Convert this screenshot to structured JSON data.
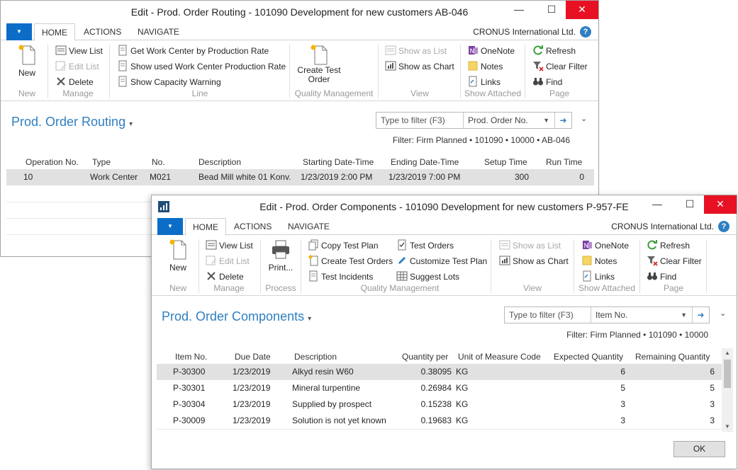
{
  "win1": {
    "title": "Edit - Prod. Order Routing - 101090 Development for new customers AB-046",
    "tabs": [
      "HOME",
      "ACTIONS",
      "NAVIGATE"
    ],
    "company": "CRONUS International Ltd.",
    "help": "?",
    "ribbon": {
      "new": "New",
      "view_list": "View List",
      "edit_list": "Edit List",
      "delete": "Delete",
      "get_wc": "Get Work Center by Production Rate",
      "show_used_wc": "Show used Work Center Production Rate",
      "show_cap_warn": "Show Capacity Warning",
      "create_test_order_1": "Create Test",
      "create_test_order_2": "Order",
      "show_as_list": "Show as List",
      "show_as_chart": "Show as Chart",
      "onenote": "OneNote",
      "notes": "Notes",
      "links": "Links",
      "refresh": "Refresh",
      "clear_filter": "Clear Filter",
      "find": "Find",
      "groups": {
        "new": "New",
        "manage": "Manage",
        "line": "Line",
        "qm": "Quality Management",
        "view": "View",
        "show_attached": "Show Attached",
        "page": "Page"
      }
    },
    "page_title": "Prod. Order Routing",
    "filter_placeholder": "Type to filter (F3)",
    "filter_field": "Prod. Order No.",
    "filter_text": "Filter: Firm Planned • 101090 • 10000 • AB-046",
    "columns": [
      "Operation No.",
      "Type",
      "No.",
      "Description",
      "Starting Date-Time",
      "Ending Date-Time",
      "Setup Time",
      "Run Time"
    ],
    "rows": [
      {
        "op": "10",
        "type": "Work Center",
        "no": "M021",
        "desc": "Bead Mill white 01 Konv.",
        "start": "1/23/2019 2:00 PM",
        "end": "1/23/2019 7:00 PM",
        "setup": "300",
        "run": "0"
      }
    ]
  },
  "win2": {
    "title": "Edit - Prod. Order Components - 101090 Development for new customers P-957-FE",
    "tabs": [
      "HOME",
      "ACTIONS",
      "NAVIGATE"
    ],
    "company": "CRONUS International Ltd.",
    "help": "?",
    "ribbon": {
      "new": "New",
      "view_list": "View List",
      "edit_list": "Edit List",
      "delete": "Delete",
      "print": "Print...",
      "copy_test_plan": "Copy Test Plan",
      "create_test_orders": "Create Test Orders",
      "test_incidents": "Test Incidents",
      "test_orders": "Test Orders",
      "customize_test_plan": "Customize Test Plan",
      "suggest_lots": "Suggest Lots",
      "show_as_list": "Show as List",
      "show_as_chart": "Show as Chart",
      "onenote": "OneNote",
      "notes": "Notes",
      "links": "Links",
      "refresh": "Refresh",
      "clear_filter": "Clear Filter",
      "find": "Find",
      "groups": {
        "new": "New",
        "manage": "Manage",
        "process": "Process",
        "qm": "Quality Management",
        "view": "View",
        "show_attached": "Show Attached",
        "page": "Page"
      }
    },
    "page_title": "Prod. Order Components",
    "filter_placeholder": "Type to filter (F3)",
    "filter_field": "Item No.",
    "filter_text": "Filter: Firm Planned • 101090 • 10000",
    "columns": [
      "Item No.",
      "Due Date",
      "Description",
      "Quantity per",
      "Unit of Measure Code",
      "Expected Quantity",
      "Remaining Quantity"
    ],
    "rows": [
      {
        "item": "P-30300",
        "due": "1/23/2019",
        "desc": "Alkyd resin W60",
        "qty": "0.38095",
        "uom": "KG",
        "exp": "6",
        "rem": "6"
      },
      {
        "item": "P-30301",
        "due": "1/23/2019",
        "desc": "Mineral turpentine",
        "qty": "0.26984",
        "uom": "KG",
        "exp": "5",
        "rem": "5"
      },
      {
        "item": "P-30304",
        "due": "1/23/2019",
        "desc": "Supplied by prospect",
        "qty": "0.15238",
        "uom": "KG",
        "exp": "3",
        "rem": "3"
      },
      {
        "item": "P-30009",
        "due": "1/23/2019",
        "desc": "Solution is not yet known",
        "qty": "0.19683",
        "uom": "KG",
        "exp": "3",
        "rem": "3"
      }
    ],
    "ok": "OK"
  },
  "colors": {
    "accent": "#2f7fc1",
    "app_menu": "#0c6dc9",
    "close": "#e81123",
    "selected_row": "#e1e1e1"
  }
}
